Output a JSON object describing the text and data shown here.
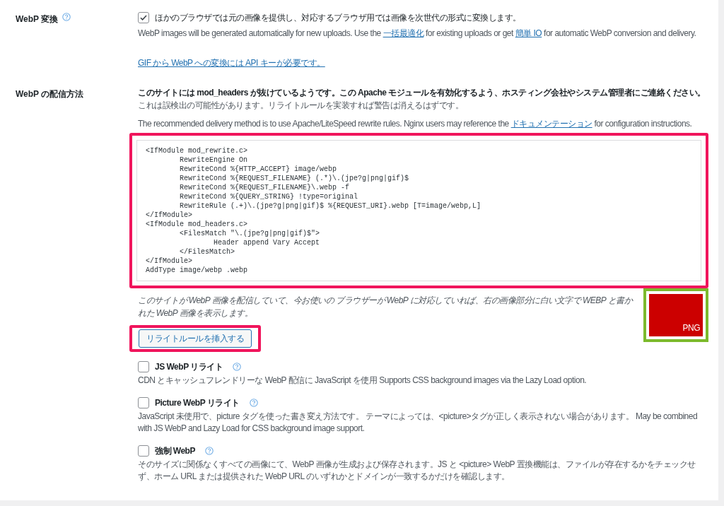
{
  "sections": [
    {
      "label": "WebP 変換",
      "help": true,
      "kind": "conversion",
      "checkbox": {
        "label": "ほかのブラウザでは元の画像を提供し、対応するブラウザ用では画像を次世代の形式に変換します。",
        "checked": true
      },
      "description": [
        {
          "kind": "text",
          "text": "WebP images will be generated automatically for new uploads. Use the "
        },
        {
          "kind": "link",
          "text": "一括最適化"
        },
        {
          "kind": "text",
          "text": " for existing uploads or get "
        },
        {
          "kind": "link",
          "text": "簡単 IO"
        },
        {
          "kind": "text",
          "text": " for automatic WebP conversion and delivery."
        }
      ],
      "notice_link": "GIF から WebP への変換には API キーが必要です。"
    },
    {
      "label": "WebP の配信方法",
      "help": false,
      "kind": "delivery",
      "warning": "このサイトには mod_headers が抜けているようです。この Apache モジュールを有効化するよう、ホスティング会社やシステム管理者にご連絡ください。",
      "warning_note": "これは誤検出の可能性があります。リライトルールを実装すれば警告は消えるはずです。",
      "recommendation": [
        {
          "kind": "text",
          "text": "The recommended delivery method is to use Apache/LiteSpeed rewrite rules. Nginx users may reference the "
        },
        {
          "kind": "link",
          "text": "ドキュメンテーション"
        },
        {
          "kind": "text",
          "text": " for configuration instructions."
        }
      ],
      "code": "<IfModule mod_rewrite.c>\n\tRewriteEngine On\n\tRewriteCond %{HTTP_ACCEPT} image/webp\n\tRewriteCond %{REQUEST_FILENAME} (.*)\\.(jpe?g|png|gif)$\n\tRewriteCond %{REQUEST_FILENAME}\\.webp -f\n\tRewriteCond %{QUERY_STRING} !type=original\n\tRewriteRule (.+)\\.(jpe?g|png|gif)$ %{REQUEST_URI}.webp [T=image/webp,L]\n</IfModule>\n<IfModule mod_headers.c>\n\t<FilesMatch \"\\.(jpe?g|png|gif)$\">\n\t\tHeader append Vary Accept\n\t</FilesMatch>\n</IfModule>\nAddType image/webp .webp",
      "test_note": "このサイトが WebP 画像を配信していて、今お使いの ブラウザーが WebP に対応していれば、右の画像部分に白い文字で WEBP と書かれた WebP 画像を表示します。",
      "test_image": {
        "label": "PNG",
        "color": "#cc0000"
      },
      "button": "リライトルールを挿入する",
      "options": [
        {
          "label": "JS WebP リライト",
          "checked": false,
          "description": "CDN とキャッシュフレンドリーな WebP 配信に JavaScript を使用 Supports CSS background images via the Lazy Load option."
        },
        {
          "label": "Picture WebP リライト",
          "checked": false,
          "description": "JavaScript 未使用で、picture タグを使った書き変え方法です。 テーマによっては、<picture>タグが正しく表示されない場合があります。 May be combined with JS WebP and Lazy Load for CSS background image support."
        },
        {
          "label": "強制 WebP",
          "checked": false,
          "description": "そのサイズに関係なくすべての画像にて、WebP 画像が生成および保存されます。JS と <picture> WebP 置換機能は、ファイルが存在するかをチェックせず、ホーム URL または提供された WebP URL のいずれかとドメインが一致するかだけを確認します。"
        }
      ]
    }
  ]
}
